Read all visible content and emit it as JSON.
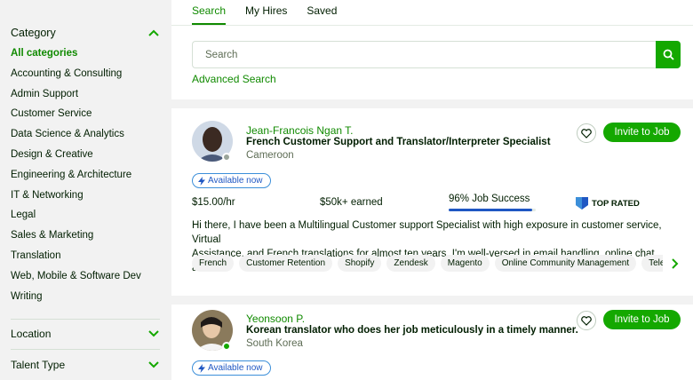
{
  "sidebar": {
    "category_title": "Category",
    "categories": [
      {
        "label": "All categories",
        "active": true
      },
      {
        "label": "Accounting & Consulting"
      },
      {
        "label": "Admin Support"
      },
      {
        "label": "Customer Service"
      },
      {
        "label": "Data Science & Analytics"
      },
      {
        "label": "Design & Creative"
      },
      {
        "label": "Engineering & Architecture"
      },
      {
        "label": "IT & Networking"
      },
      {
        "label": "Legal"
      },
      {
        "label": "Sales & Marketing"
      },
      {
        "label": "Translation"
      },
      {
        "label": "Web, Mobile & Software Dev"
      },
      {
        "label": "Writing"
      }
    ],
    "location_title": "Location",
    "talent_type_title": "Talent Type"
  },
  "tabs": {
    "search": "Search",
    "my_hires": "My Hires",
    "saved": "Saved"
  },
  "search": {
    "placeholder": "Search",
    "advanced_label": "Advanced Search"
  },
  "freelancers": [
    {
      "name": "Jean-Francois Ngan T.",
      "title": "French Customer Support and Translator/Interpreter Specialist",
      "location": "Cameroon",
      "availability": "Available now",
      "rate": "$15.00/hr",
      "earned": "$50k+ earned",
      "job_success": "96% Job Success",
      "job_success_value": 96,
      "badge": "TOP RATED",
      "description_line1": "Hi there, I have been a Multilingual Customer support Specialist with high exposure in customer service, Virtual",
      "description_line2": "Assistance, and French translations for almost ten years. I'm well-versed in email handling, online chat, and...",
      "skills": [
        "French",
        "Customer Retention",
        "Shopify",
        "Zendesk",
        "Magento",
        "Online Community Management",
        "Telephone"
      ],
      "invite_label": "Invite to Job",
      "status_color": "#9aa59a"
    },
    {
      "name": "Yeonsoon P.",
      "title": "Korean translator who does her job meticulously in a timely manner.",
      "location": "South Korea",
      "availability": "Available now",
      "invite_label": "Invite to Job",
      "status_color": "#14a800"
    }
  ],
  "colors": {
    "accent": "#14a800",
    "link_green": "#108a00",
    "badge_blue": "#1f57c3"
  }
}
